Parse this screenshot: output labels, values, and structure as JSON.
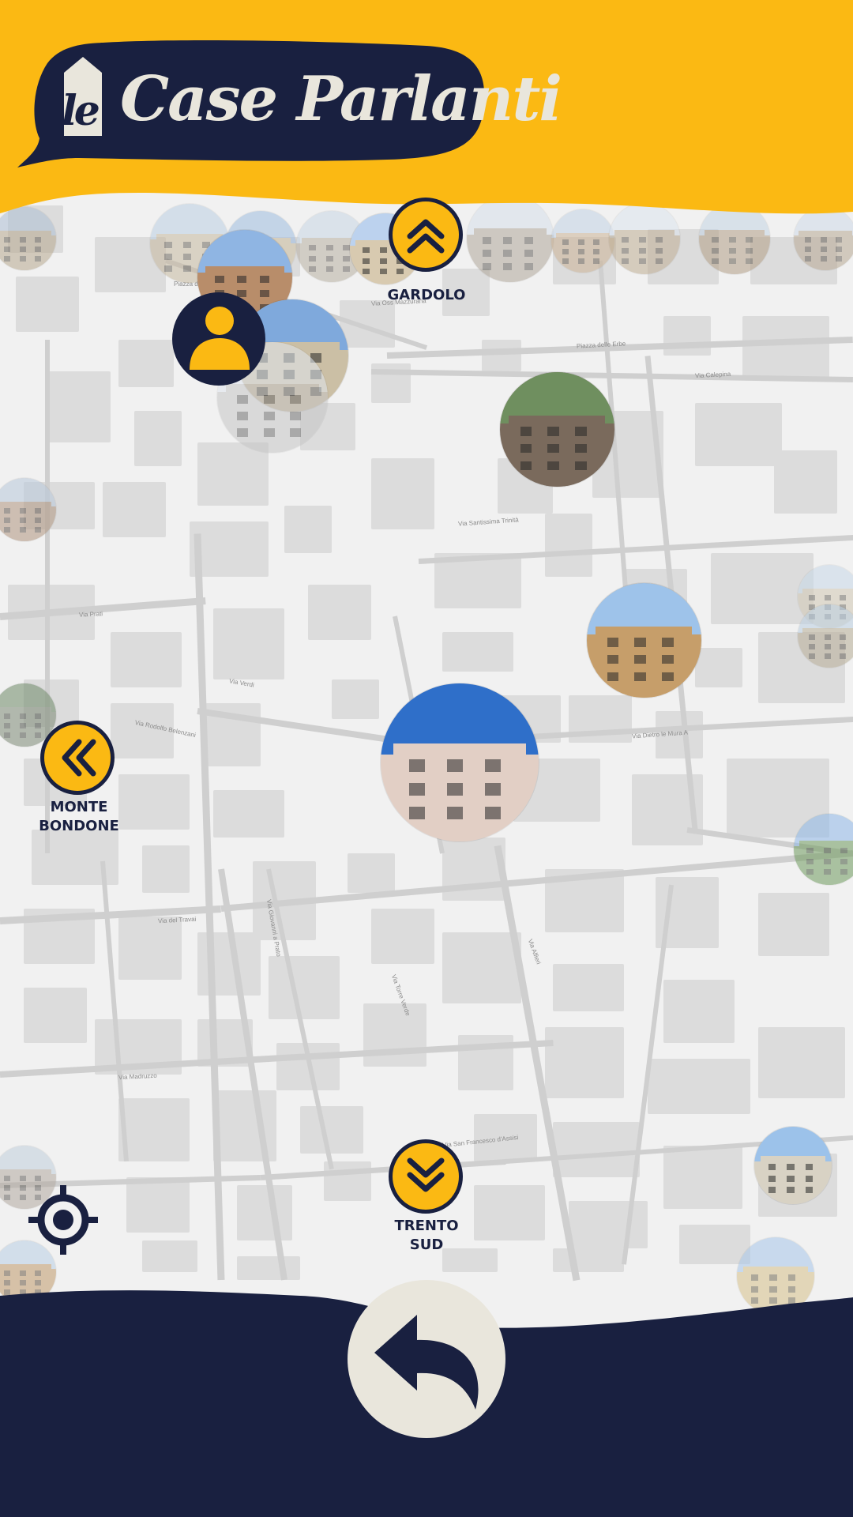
{
  "app": {
    "title": "le Case Parlanti",
    "logo_prefix": "le",
    "logo_text": "Case Parlanti"
  },
  "colors": {
    "brand_yellow": "#fbb913",
    "brand_navy": "#192040",
    "cream": "#e9e6dc",
    "map_background": "#f1f1f1"
  },
  "navigation": {
    "north": {
      "label": "GARDOLO",
      "icon": "double-chevron-up-icon"
    },
    "west": {
      "label_line1": "MONTE",
      "label_line2": "BONDONE",
      "icon": "double-chevron-left-icon"
    },
    "south": {
      "label_line1": "TRENTO",
      "label_line2": "SUD",
      "icon": "double-chevron-down-icon"
    }
  },
  "controls": {
    "user_location": "user-icon",
    "locate_me": "crosshair-icon",
    "back": "undo-arrow-icon"
  },
  "streets": [
    "Piazza del Duomo",
    "Via Oss Mazzurana",
    "Piazza delle Erbe",
    "Via Calepina",
    "Via Santissima Trinità",
    "Via Prati",
    "Via Verdi",
    "Via Rodolfo Belenzani",
    "Via Dietro le Mura A",
    "Via del Travai",
    "Via Madruzzo",
    "Via San Francesco d'Assisi",
    "Via Giovanni a Prato",
    "Via Torre Verde",
    "Via Alfieri"
  ]
}
